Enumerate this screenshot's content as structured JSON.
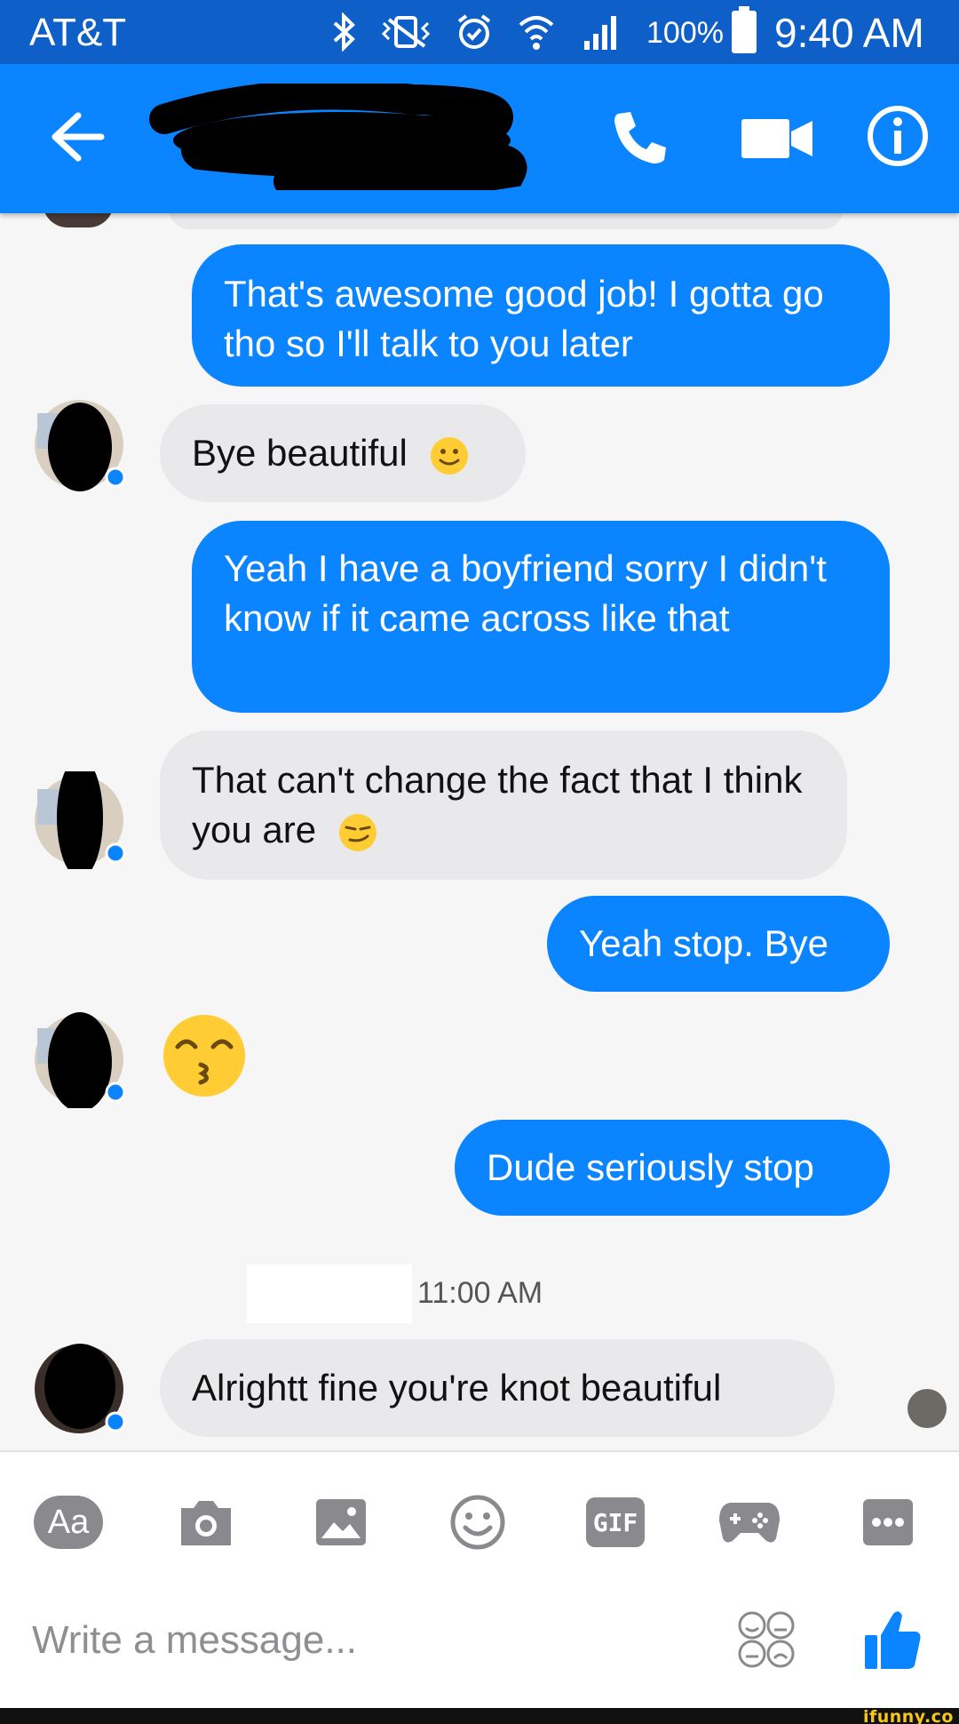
{
  "status_bar": {
    "carrier": "AT&T",
    "battery_pct": "100%",
    "time": "9:40 AM",
    "icons": [
      "bluetooth-icon",
      "vibrate-icon",
      "alarm-icon",
      "wifi-icon",
      "signal-icon",
      "battery-icon"
    ]
  },
  "header": {
    "back_icon": "arrow-left-icon",
    "contact_name_redacted": true,
    "actions": [
      "phone-icon",
      "video-camera-icon",
      "info-icon"
    ],
    "color": "#0a84ff"
  },
  "messages": [
    {
      "from": "me",
      "text": "That's awesome good job! I gotta go tho so I'll talk to you later"
    },
    {
      "from": "them",
      "text": "Bye beautiful",
      "emoji": "slightly-smiling-face"
    },
    {
      "from": "me",
      "text": "Yeah I have a boyfriend sorry I didn't know if it came across like that"
    },
    {
      "from": "them",
      "text": "That can't change the fact that I think you are",
      "emoji": "smirking-face"
    },
    {
      "from": "me",
      "text": "Yeah stop. Bye"
    },
    {
      "from": "them",
      "emoji": "kissing-face-with-smiling-eyes"
    },
    {
      "from": "me",
      "text": "Dude seriously stop"
    },
    {
      "from": "them",
      "text": "Alrightt fine you're knot beautiful"
    }
  ],
  "timestamp": "11:00 AM",
  "composer": {
    "tools": [
      "text-aa-icon",
      "camera-icon",
      "image-icon",
      "emoji-icon",
      "gif-icon",
      "game-icon",
      "more-icon"
    ],
    "aa_label": "Aa",
    "gif_label": "GIF",
    "placeholder": "Write a message...",
    "stickers_icon": "sticker-faces-icon",
    "like_icon": "thumbs-up-icon"
  },
  "watermark": "ifunny.co",
  "colors": {
    "outgoing": "#0a84ff",
    "incoming": "#e9e9eb",
    "status_bar": "#0f5fc8"
  }
}
